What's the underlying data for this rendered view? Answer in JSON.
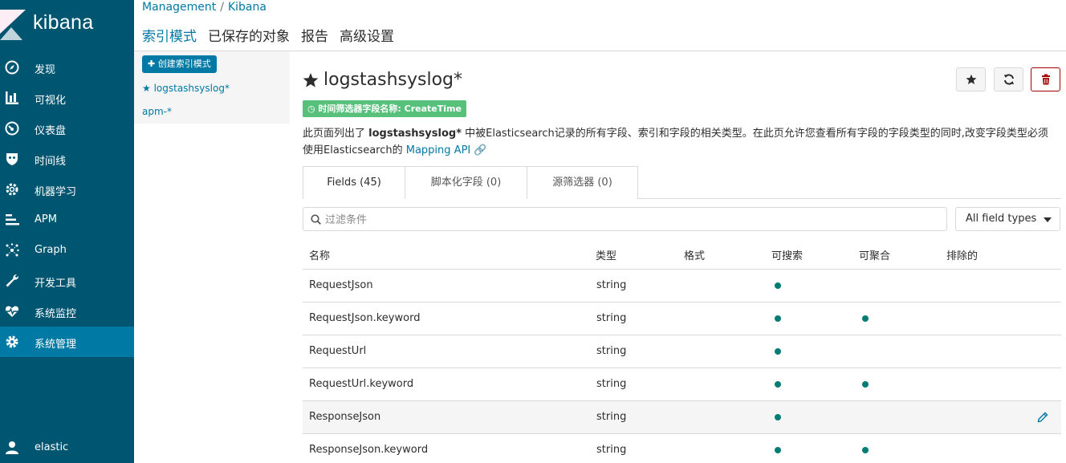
{
  "app": {
    "logo_text": "kibana"
  },
  "sidebar": {
    "items": [
      {
        "label": "发现",
        "icon": "compass-icon"
      },
      {
        "label": "可视化",
        "icon": "bar-chart-icon"
      },
      {
        "label": "仪表盘",
        "icon": "dashboard-gauge-icon"
      },
      {
        "label": "时间线",
        "icon": "shield-timeline-icon"
      },
      {
        "label": "机器学习",
        "icon": "ml-gear-icon"
      },
      {
        "label": "APM",
        "icon": "apm-lines-icon"
      },
      {
        "label": "Graph",
        "icon": "graph-network-icon"
      },
      {
        "label": "开发工具",
        "icon": "wrench-icon"
      },
      {
        "label": "系统监控",
        "icon": "heartbeat-icon"
      },
      {
        "label": "系统管理",
        "icon": "gear-icon",
        "active": true
      }
    ],
    "user": "elastic"
  },
  "breadcrumb": {
    "root": "Management",
    "separator": "/",
    "current": "Kibana"
  },
  "top_tabs": [
    {
      "label": "索引模式",
      "active": true
    },
    {
      "label": "已保存的对象"
    },
    {
      "label": "报告"
    },
    {
      "label": "高级设置"
    }
  ],
  "index_panel": {
    "create_label": "创建索引模式",
    "patterns": [
      {
        "label": "logstashsyslog*",
        "default": true
      },
      {
        "label": "apm-*"
      }
    ]
  },
  "main": {
    "title": "logstashsyslog*",
    "time_badge": "时间筛选器字段名称: CreateTime",
    "desc_prefix": "此页面列出了 ",
    "desc_bold": "logstashsyslog*",
    "desc_suffix": " 中被Elasticsearch记录的所有字段、索引和字段的相关类型。在此页允许您查看所有字段的字段类型的同时,改变字段类型必须使用Elasticsearch的 ",
    "desc_link": "Mapping API",
    "colors": {
      "accent": "#0079a5",
      "sidebar": "#005571",
      "badge": "#57c17b",
      "dot": "#017d73",
      "danger": "#a30000"
    }
  },
  "sub_tabs": [
    {
      "label": "Fields (45)",
      "active": true
    },
    {
      "label": "脚本化字段 (0)"
    },
    {
      "label": "源筛选器 (0)"
    }
  ],
  "filter": {
    "placeholder": "过滤条件",
    "type_select": "All field types"
  },
  "table": {
    "headers": [
      "名称",
      "类型",
      "格式",
      "可搜索",
      "可聚合",
      "排除的"
    ],
    "rows": [
      {
        "name": "RequestJson",
        "type": "string",
        "format": "",
        "searchable": true,
        "aggregatable": false
      },
      {
        "name": "RequestJson.keyword",
        "type": "string",
        "format": "",
        "searchable": true,
        "aggregatable": true
      },
      {
        "name": "RequestUrl",
        "type": "string",
        "format": "",
        "searchable": true,
        "aggregatable": false
      },
      {
        "name": "RequestUrl.keyword",
        "type": "string",
        "format": "",
        "searchable": true,
        "aggregatable": true
      },
      {
        "name": "ResponseJson",
        "type": "string",
        "format": "",
        "searchable": true,
        "aggregatable": false,
        "hover": true
      },
      {
        "name": "ResponseJson.keyword",
        "type": "string",
        "format": "",
        "searchable": true,
        "aggregatable": true
      }
    ]
  }
}
